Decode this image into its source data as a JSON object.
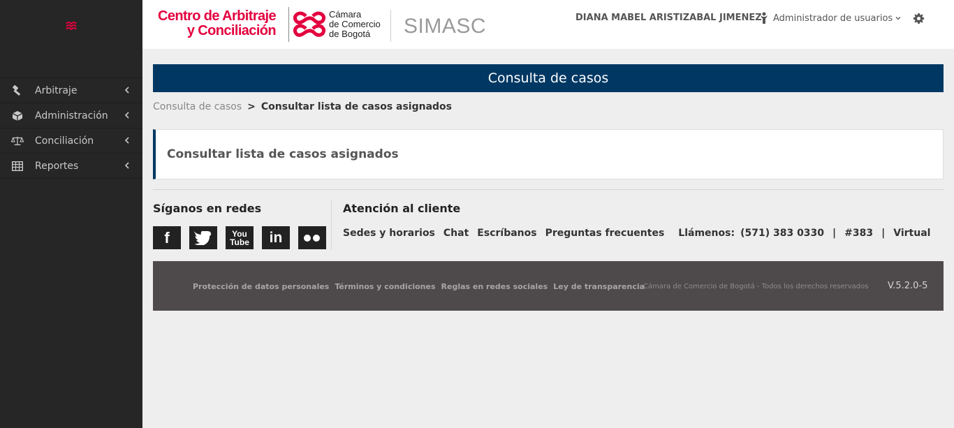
{
  "sidebar": {
    "logo_icon": "ccb-logo-icon",
    "items": [
      {
        "label": "Arbitraje",
        "icon": "gavel-icon"
      },
      {
        "label": "Administración",
        "icon": "cube-icon"
      },
      {
        "label": "Conciliación",
        "icon": "balance-scale-icon"
      },
      {
        "label": "Reportes",
        "icon": "table-icon"
      }
    ]
  },
  "header": {
    "brand_line1": "Centro de Arbitraje",
    "brand_line2": "y Conciliación",
    "ccb_line1": "Cámara",
    "ccb_line2": "de Comercio",
    "ccb_line3": "de Bogotá",
    "app_name": "SIMASC",
    "user_name": "DIANA MABEL ARISTIZABAL JIMENEZ",
    "role": "Administrador de usuarios",
    "settings_icon": "gear-icon"
  },
  "page": {
    "title": "Consulta de casos",
    "breadcrumb": {
      "parent": "Consulta de casos",
      "separator": ">",
      "current": "Consultar lista de casos asignados"
    },
    "panel_title": "Consultar lista de casos asignados"
  },
  "social": {
    "title": "Síganos en redes",
    "networks": [
      "facebook-icon",
      "twitter-icon",
      "youtube-icon",
      "linkedin-icon",
      "flickr-icon"
    ],
    "youtube_top": "You",
    "youtube_bottom": "Tube",
    "linkedin_text": "in",
    "facebook_text": "f"
  },
  "attention": {
    "title": "Atención al cliente",
    "links": [
      "Sedes y horarios",
      "Chat",
      "Escríbanos",
      "Preguntas frecuentes"
    ],
    "call_label": "Llámenos:",
    "phone": "(571) 383 0330",
    "sep": "|",
    "short_code": "#383",
    "virtual": "Virtual"
  },
  "footer": {
    "links": [
      "Protección de datos personales",
      "Términos y condiciones",
      "Reglas en redes sociales",
      "Ley de transparencia"
    ],
    "copyright": "Cámara de Comercio de Bogotá - Todos los derechos reservados",
    "version": "V.5.2.0-5"
  },
  "colors": {
    "brand_red": "#e3003f",
    "navy": "#003863",
    "sidebar_bg": "#262626",
    "footer_bg": "#4e4a4b"
  }
}
